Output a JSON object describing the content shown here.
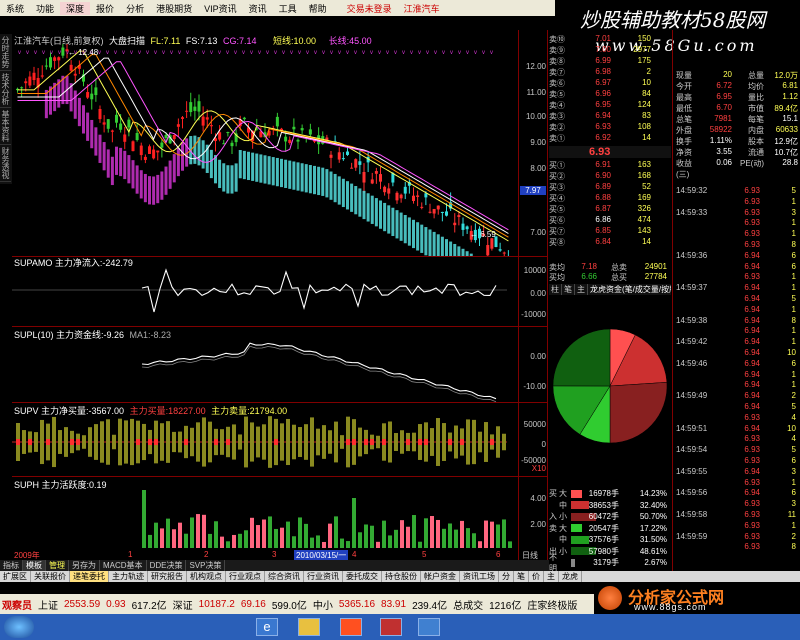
{
  "menu": {
    "items": [
      "系统",
      "功能",
      "深度",
      "报价",
      "分析",
      "港股期货",
      "VIP资讯",
      "资讯",
      "工具",
      "帮助"
    ],
    "trade": "交易未登录",
    "stock_name": "江淮汽车"
  },
  "brand": {
    "line1": "炒股辅助教材58股网",
    "line2": "www.58Gu.com"
  },
  "side_tabs": [
    "分时走势",
    "技术分析",
    "基本资料",
    "财务透视"
  ],
  "chart_title": "江淮汽车(日线,前复权)",
  "main_indicators": {
    "label1": "大盘扫描",
    "fl": "FL:7.11",
    "fs": "FS:7.13",
    "cg": "CG:7.14",
    "short": "短线:10.00",
    "long": "长线:45.00"
  },
  "main_axis": [
    "12.00",
    "11.00",
    "10.00",
    "9.00",
    "8.00",
    "7.00"
  ],
  "annotations": {
    "high": "12.48",
    "low": "6.59",
    "current": "7.97"
  },
  "panels": {
    "supamo": {
      "title": "SUPAMO 主力净流入:-242.79",
      "axis": [
        "10000",
        "0.00",
        "-10000"
      ]
    },
    "supl": {
      "title": "SUPL(10) 主力资金线:-9.26",
      "ma": "MA1:-8.23",
      "axis": [
        "0.00",
        "-10.00"
      ]
    },
    "supv": {
      "title": "SUPV 主力净买量:-3567.00",
      "buy": "主力买量:18227.00",
      "sell": "主力卖量:21794.00",
      "axis": [
        "50000",
        "0",
        "-50000",
        "X10"
      ]
    },
    "suph": {
      "title": "SUPH 主力活跃度:0.19",
      "axis": [
        "4.00",
        "2.00"
      ]
    }
  },
  "xaxis": {
    "year": "2009年",
    "date": "2010/03/15/一",
    "ticks": [
      "1",
      "2",
      "3",
      "4",
      "5",
      "6"
    ]
  },
  "right_tab_day": "日线",
  "order_book": {
    "sell": [
      {
        "label": "卖⑩",
        "price": "7.01",
        "vol": "150",
        "dir": "green"
      },
      {
        "label": "卖⑨",
        "price": "7.00",
        "vol": "2977",
        "dir": "green"
      },
      {
        "label": "卖⑧",
        "price": "6.99",
        "vol": "175",
        "dir": "green"
      },
      {
        "label": "卖⑦",
        "price": "6.98",
        "vol": "2",
        "dir": "green"
      },
      {
        "label": "卖⑥",
        "price": "6.97",
        "vol": "10",
        "dir": "green"
      },
      {
        "label": "卖⑤",
        "price": "6.96",
        "vol": "84",
        "dir": "green"
      },
      {
        "label": "卖④",
        "price": "6.95",
        "vol": "124",
        "dir": "green"
      },
      {
        "label": "卖③",
        "price": "6.94",
        "vol": "83",
        "dir": "green"
      },
      {
        "label": "卖②",
        "price": "6.93",
        "vol": "108",
        "dir": "green"
      },
      {
        "label": "卖①",
        "price": "6.92",
        "vol": "14",
        "dir": "green"
      }
    ],
    "current": "6.93",
    "buy": [
      {
        "label": "买①",
        "price": "6.91",
        "vol": "163",
        "dir": ""
      },
      {
        "label": "买②",
        "price": "6.90",
        "vol": "168",
        "dir": ""
      },
      {
        "label": "买③",
        "price": "6.89",
        "vol": "52",
        "dir": ""
      },
      {
        "label": "买④",
        "price": "6.88",
        "vol": "169",
        "dir": ""
      },
      {
        "label": "买⑤",
        "price": "6.87",
        "vol": "326",
        "dir": ""
      },
      {
        "label": "买⑥",
        "price": "6.86",
        "vol": "474",
        "dir": ""
      },
      {
        "label": "买⑦",
        "price": "6.85",
        "vol": "143",
        "dir": ""
      },
      {
        "label": "买⑧",
        "price": "6.84",
        "vol": "14",
        "dir": ""
      }
    ],
    "avg_sell": {
      "label": "卖均",
      "price": "7.18",
      "k": "总卖",
      "v": "24901"
    },
    "avg_buy": {
      "label": "买均",
      "price": "6.66",
      "k": "总买",
      "v": "27784"
    }
  },
  "stats": [
    {
      "k": "现量",
      "v1": "20",
      "k2": "总量",
      "v2": "12.0万"
    },
    {
      "k": "今开",
      "v1": "6.72",
      "k2": "均价",
      "v2": "6.81"
    },
    {
      "k": "最高",
      "v1": "6.95",
      "k2": "量比",
      "v2": "1.12"
    },
    {
      "k": "最低",
      "v1": "6.70",
      "k2": "市值",
      "v2": "89.4亿"
    },
    {
      "k": "总笔",
      "v1": "7981",
      "k2": "每笔",
      "v2": "15.1"
    },
    {
      "k": "外盘",
      "v1": "58922",
      "k2": "内盘",
      "v2": "60633"
    },
    {
      "k": "换手",
      "v1": "1.11%",
      "k2": "股本",
      "v2": "12.9亿"
    },
    {
      "k": "净资",
      "v1": "3.55",
      "k2": "流通",
      "v2": "10.7亿"
    },
    {
      "k": "收益(三)",
      "v1": "0.06",
      "k2": "PE(动)",
      "v2": "28.8"
    }
  ],
  "ticks": [
    {
      "t": "14:59:32",
      "p": "6.93",
      "v": "5"
    },
    {
      "t": "",
      "p": "6.93",
      "v": "1"
    },
    {
      "t": "14:59:33",
      "p": "6.93",
      "v": "3"
    },
    {
      "t": "",
      "p": "6.93",
      "v": "1"
    },
    {
      "t": "",
      "p": "6.93",
      "v": "1"
    },
    {
      "t": "",
      "p": "6.93",
      "v": "8"
    },
    {
      "t": "14:59:36",
      "p": "6.94",
      "v": "6"
    },
    {
      "t": "",
      "p": "6.94",
      "v": "6"
    },
    {
      "t": "",
      "p": "6.93",
      "v": "1"
    },
    {
      "t": "14:59:37",
      "p": "6.94",
      "v": "1"
    },
    {
      "t": "",
      "p": "6.94",
      "v": "5"
    },
    {
      "t": "",
      "p": "6.94",
      "v": "1"
    },
    {
      "t": "14:59:38",
      "p": "6.94",
      "v": "8"
    },
    {
      "t": "",
      "p": "6.94",
      "v": "1"
    },
    {
      "t": "14:59:42",
      "p": "6.94",
      "v": "1"
    },
    {
      "t": "",
      "p": "6.94",
      "v": "10"
    },
    {
      "t": "14:59:46",
      "p": "6.94",
      "v": "6"
    },
    {
      "t": "",
      "p": "6.94",
      "v": "1"
    },
    {
      "t": "",
      "p": "6.94",
      "v": "1"
    },
    {
      "t": "14:59:49",
      "p": "6.94",
      "v": "2"
    },
    {
      "t": "",
      "p": "6.94",
      "v": "5"
    },
    {
      "t": "",
      "p": "6.93",
      "v": "4"
    },
    {
      "t": "14:59:51",
      "p": "6.94",
      "v": "10"
    },
    {
      "t": "",
      "p": "6.93",
      "v": "4"
    },
    {
      "t": "14:59:54",
      "p": "6.93",
      "v": "5"
    },
    {
      "t": "",
      "p": "6.93",
      "v": "6"
    },
    {
      "t": "14:59:55",
      "p": "6.94",
      "v": "3"
    },
    {
      "t": "",
      "p": "6.93",
      "v": "1"
    },
    {
      "t": "14:59:56",
      "p": "6.94",
      "v": "6"
    },
    {
      "t": "",
      "p": "6.93",
      "v": "3"
    },
    {
      "t": "14:59:58",
      "p": "6.93",
      "v": "11"
    },
    {
      "t": "",
      "p": "6.93",
      "v": "1"
    },
    {
      "t": "14:59:59",
      "p": "6.93",
      "v": "2"
    },
    {
      "t": "",
      "p": "6.93",
      "v": "8"
    }
  ],
  "mid_tabs": [
    "柱",
    "笔",
    "主",
    "龙虎资金(笔/成交量/按所有"
  ],
  "flows": [
    {
      "a": "买",
      "b": "大",
      "n": "16978手",
      "pc": "14.23%",
      "color": "#ff5050",
      "w": 30
    },
    {
      "a": "",
      "b": "中",
      "n": "38653手",
      "pc": "32.40%",
      "color": "#cc3030",
      "w": 50
    },
    {
      "a": "入",
      "b": "小",
      "n": "60472手",
      "pc": "50.70%",
      "color": "#882020",
      "w": 70
    },
    {
      "a": "卖",
      "b": "大",
      "n": "20547手",
      "pc": "17.22%",
      "color": "#30cc30",
      "w": 30
    },
    {
      "a": "",
      "b": "中",
      "n": "37576手",
      "pc": "31.50%",
      "color": "#20a020",
      "w": 50
    },
    {
      "a": "出",
      "b": "小",
      "n": "57980手",
      "pc": "48.61%",
      "color": "#106010",
      "w": 70
    },
    {
      "a": "不明",
      "b": "",
      "n": "3179手",
      "pc": "2.67%",
      "color": "#888888",
      "w": 10
    }
  ],
  "bottom_tabs": [
    "指标",
    "模板",
    "管理",
    "另存为",
    "MACD基本",
    "DDE决策",
    "SVP决策"
  ],
  "func_bar": [
    "扩展区",
    "关联报价",
    "递笔委托",
    "主力轨迹",
    "研究报告",
    "机构观点",
    "行业观点",
    "综合资讯",
    "行业资讯",
    "委托成交",
    "持仓股份",
    "帐户资金",
    "资讯工场",
    "分",
    "笔",
    "价",
    "主",
    "龙虎"
  ],
  "status": {
    "label": "观察员",
    "sh": "上证",
    "sh_v": "2553.59",
    "sh_c": "0.93",
    "sh_a": "617.2亿",
    "sz": "深证",
    "sz_v": "10187.2",
    "sz_c": "69.16",
    "sz_a": "599.0亿",
    "zx": "中小",
    "zx_v": "5365.16",
    "zx_c": "83.91",
    "zx_a": "239.4亿",
    "total": "总成交",
    "total_v": "1216亿",
    "board": "庄家终极版"
  },
  "site": {
    "name": "分析家公式网",
    "url": "www.88gs.com"
  },
  "chart_data": {
    "type": "candlestick",
    "title": "江淮汽车(日线,前复权)",
    "ylim": [
      6.5,
      12.5
    ],
    "high_label": 12.48,
    "low_label": 6.59,
    "last": 7.97,
    "pie": [
      {
        "name": "买大",
        "pct": 14.23,
        "color": "#ff5050"
      },
      {
        "name": "买中",
        "pct": 32.4,
        "color": "#cc3030"
      },
      {
        "name": "买小",
        "pct": 50.7,
        "color": "#882020"
      },
      {
        "name": "卖大",
        "pct": 17.22,
        "color": "#30cc30"
      },
      {
        "name": "卖中",
        "pct": 31.5,
        "color": "#20a020"
      },
      {
        "name": "卖小",
        "pct": 48.61,
        "color": "#106010"
      }
    ]
  }
}
